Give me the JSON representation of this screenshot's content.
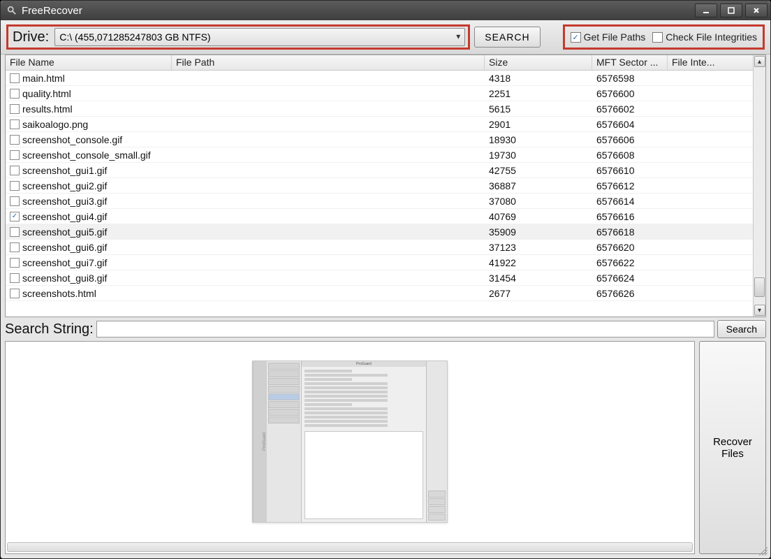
{
  "titlebar": {
    "app_name": "FreeRecover"
  },
  "toolbar": {
    "drive_label": "Drive:",
    "drive_value": "C:\\ (455,071285247803 GB NTFS)",
    "search_label": "SEARCH",
    "chk_paths_label": "Get File Paths",
    "chk_paths_checked": true,
    "chk_integ_label": "Check File Integrities",
    "chk_integ_checked": false
  },
  "table": {
    "columns": {
      "name": "File Name",
      "path": "File Path",
      "size": "Size",
      "mft": "MFT Sector ...",
      "integ": "File Inte..."
    },
    "rows": [
      {
        "checked": false,
        "name": "main.html",
        "path": "",
        "size": "4318",
        "mft": "6576598",
        "integ": ""
      },
      {
        "checked": false,
        "name": "quality.html",
        "path": "",
        "size": "2251",
        "mft": "6576600",
        "integ": ""
      },
      {
        "checked": false,
        "name": "results.html",
        "path": "",
        "size": "5615",
        "mft": "6576602",
        "integ": ""
      },
      {
        "checked": false,
        "name": "saikoalogo.png",
        "path": "",
        "size": "2901",
        "mft": "6576604",
        "integ": ""
      },
      {
        "checked": false,
        "name": "screenshot_console.gif",
        "path": "",
        "size": "18930",
        "mft": "6576606",
        "integ": ""
      },
      {
        "checked": false,
        "name": "screenshot_console_small.gif",
        "path": "",
        "size": "19730",
        "mft": "6576608",
        "integ": ""
      },
      {
        "checked": false,
        "name": "screenshot_gui1.gif",
        "path": "",
        "size": "42755",
        "mft": "6576610",
        "integ": ""
      },
      {
        "checked": false,
        "name": "screenshot_gui2.gif",
        "path": "",
        "size": "36887",
        "mft": "6576612",
        "integ": ""
      },
      {
        "checked": false,
        "name": "screenshot_gui3.gif",
        "path": "",
        "size": "37080",
        "mft": "6576614",
        "integ": ""
      },
      {
        "checked": true,
        "name": "screenshot_gui4.gif",
        "path": "",
        "size": "40769",
        "mft": "6576616",
        "integ": ""
      },
      {
        "checked": false,
        "name": "screenshot_gui5.gif",
        "path": "",
        "size": "35909",
        "mft": "6576618",
        "integ": "",
        "selected": true
      },
      {
        "checked": false,
        "name": "screenshot_gui6.gif",
        "path": "",
        "size": "37123",
        "mft": "6576620",
        "integ": ""
      },
      {
        "checked": false,
        "name": "screenshot_gui7.gif",
        "path": "",
        "size": "41922",
        "mft": "6576622",
        "integ": ""
      },
      {
        "checked": false,
        "name": "screenshot_gui8.gif",
        "path": "",
        "size": "31454",
        "mft": "6576624",
        "integ": ""
      },
      {
        "checked": false,
        "name": "screenshots.html",
        "path": "",
        "size": "2677",
        "mft": "6576626",
        "integ": ""
      }
    ]
  },
  "searchrow": {
    "label": "Search String:",
    "value": "",
    "button": "Search"
  },
  "recover": {
    "label": "Recover\nFiles"
  }
}
